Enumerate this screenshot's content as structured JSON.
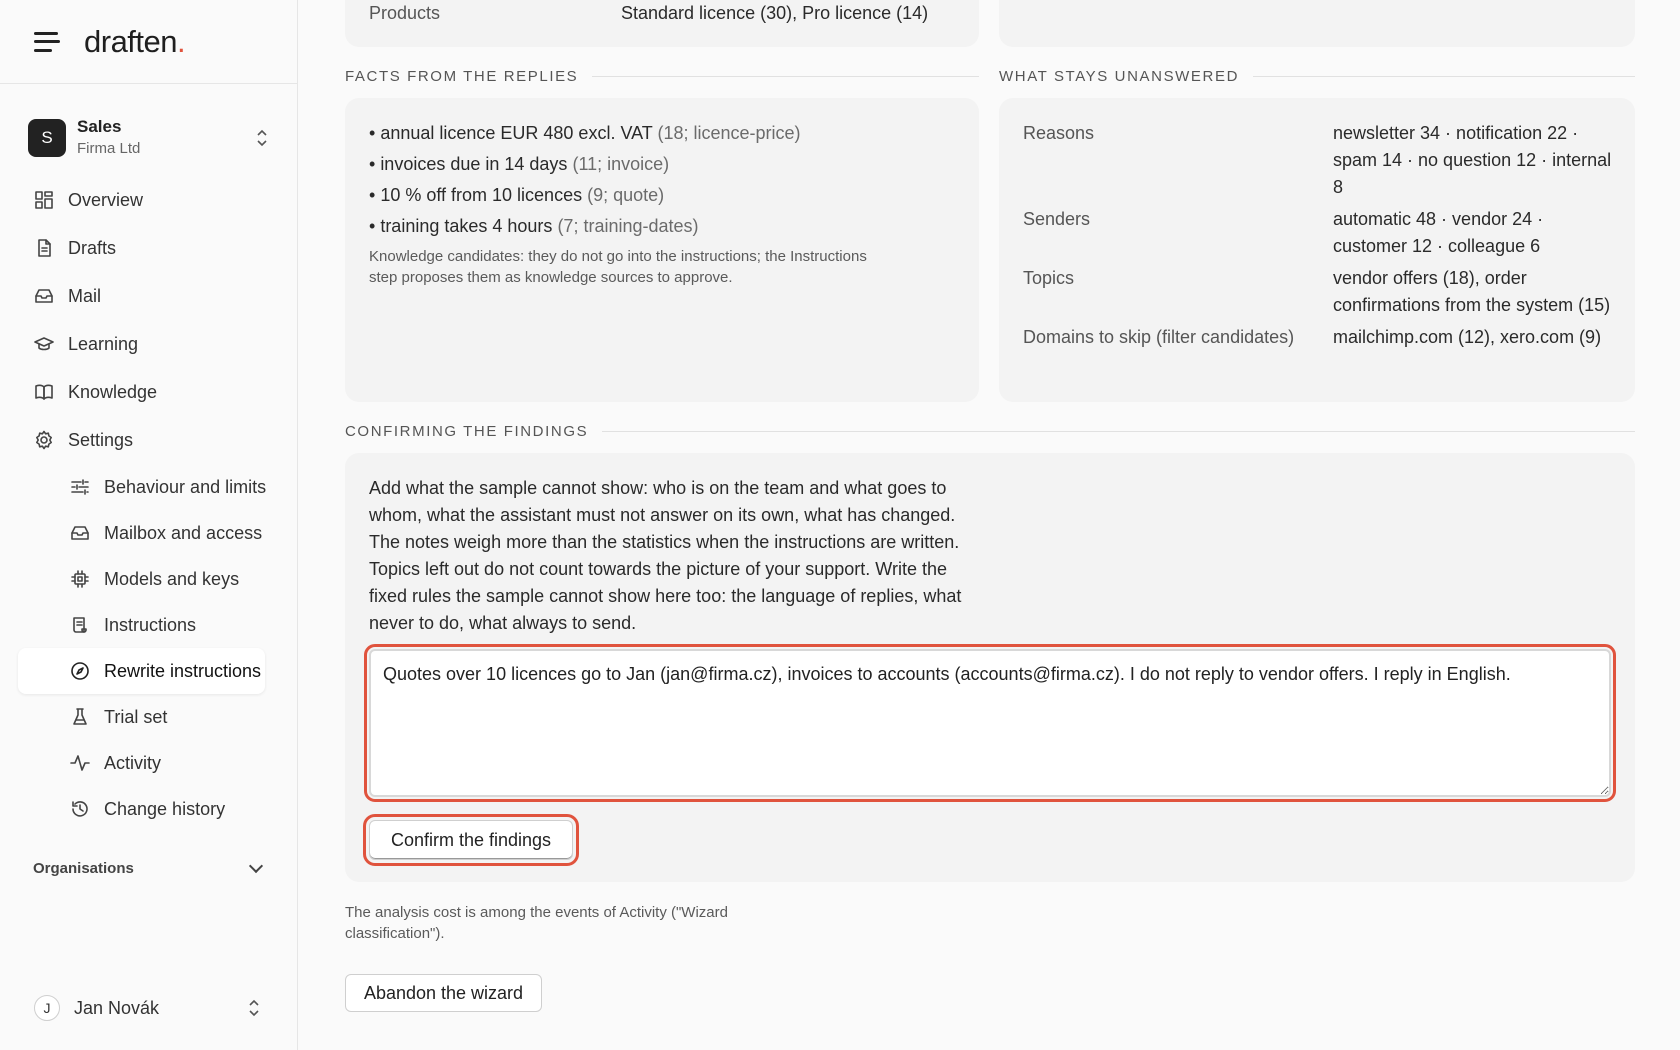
{
  "app": {
    "logo_text": "draften",
    "logo_dot": ".",
    "accent": "#e0533d"
  },
  "org": {
    "initial": "S",
    "name": "Sales",
    "company": "Firma Ltd"
  },
  "nav": {
    "overview": "Overview",
    "drafts": "Drafts",
    "mail": "Mail",
    "learning": "Learning",
    "knowledge": "Knowledge",
    "settings": "Settings"
  },
  "settings_sub": {
    "behaviour": "Behaviour and limits",
    "mailbox": "Mailbox and access",
    "models": "Models and keys",
    "instructions": "Instructions",
    "rewrite": "Rewrite instructions",
    "trial": "Trial set",
    "activity": "Activity",
    "history": "Change history"
  },
  "organisations_label": "Organisations",
  "user": {
    "initial": "J",
    "name": "Jan Novák"
  },
  "top_card": {
    "label": "Products",
    "value": "Standard licence (30), Pro licence (14)"
  },
  "facts": {
    "title": "FACTS FROM THE REPLIES",
    "items": [
      {
        "text": "annual licence EUR 480 excl. VAT",
        "meta": "(18; licence-price)"
      },
      {
        "text": "invoices due in 14 days",
        "meta": "(11; invoice)"
      },
      {
        "text": "10 % off from 10 licences",
        "meta": "(9; quote)"
      },
      {
        "text": "training takes 4 hours",
        "meta": "(7; training-dates)"
      }
    ],
    "note": "Knowledge candidates: they do not go into the instructions; the Instructions step proposes them as knowledge sources to approve."
  },
  "unanswered": {
    "title": "WHAT STAYS UNANSWERED",
    "rows": [
      {
        "key": "Reasons",
        "value": "newsletter 34 · notification 22 · spam 14 · no question 12 · internal 8"
      },
      {
        "key": "Senders",
        "value": "automatic 48 · vendor 24 · customer 12 · colleague 6"
      },
      {
        "key": "Topics",
        "value": "vendor offers (18), order confirmations from the system (15)"
      },
      {
        "key": "Domains to skip (filter candidates)",
        "value": "mailchimp.com (12), xero.com (9)"
      }
    ]
  },
  "confirm": {
    "title": "CONFIRMING THE FINDINGS",
    "description": "Add what the sample cannot show: who is on the team and what goes to whom, what the assistant must not answer on its own, what has changed. The notes weigh more than the statistics when the instructions are written. Topics left out do not count towards the picture of your support. Write the fixed rules the sample cannot show here too: the language of replies, what never to do, what always to send.",
    "notes_value": "Quotes over 10 licences go to Jan (jan@firma.cz), invoices to accounts (accounts@firma.cz). I do not reply to vendor offers. I reply in English.",
    "button": "Confirm the findings"
  },
  "footer_note": "The analysis cost is among the events of Activity (\"Wizard classification\").",
  "abandon_button": "Abandon the wizard"
}
